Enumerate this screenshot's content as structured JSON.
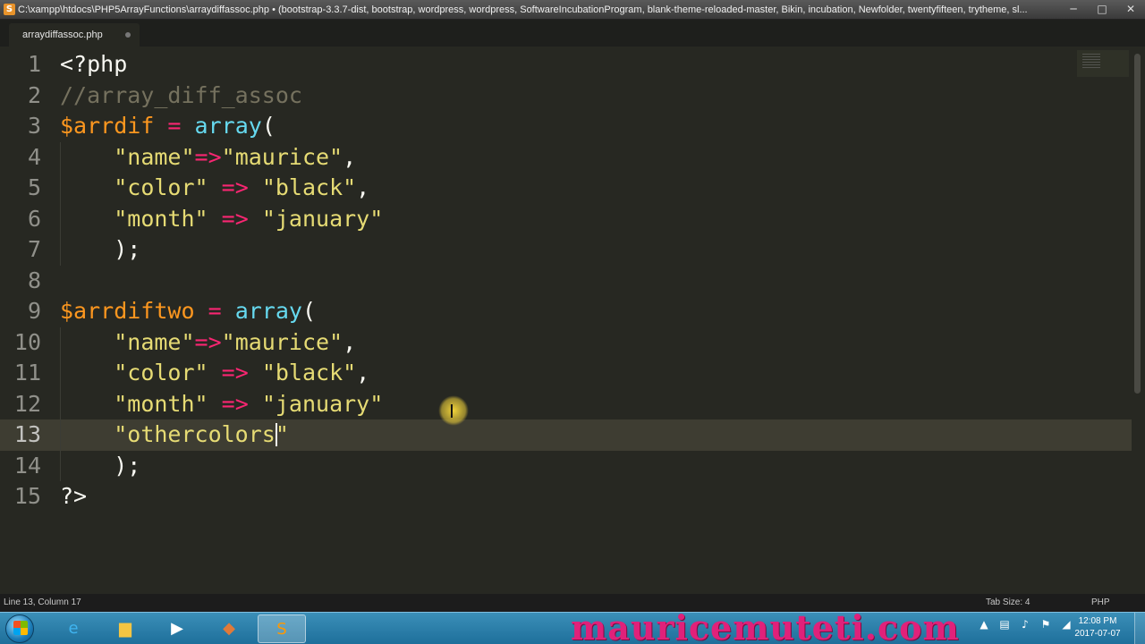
{
  "window": {
    "title": "C:\\xampp\\htdocs\\PHP5ArrayFunctions\\arraydiffassoc.php • (bootstrap-3.3.7-dist, bootstrap, wordpress, wordpress, SoftwareIncubationProgram, blank-theme-reloaded-master, Bikin, incubation, Newfolder, twentyfifteen, trytheme, sl...",
    "controls": {
      "minimize": "─",
      "maximize": "□",
      "close": "✕"
    }
  },
  "tabs": [
    {
      "label": "arraydiffassoc.php",
      "dirty": true
    }
  ],
  "editor": {
    "line_numbers": [
      "1",
      "2",
      "3",
      "4",
      "5",
      "6",
      "7",
      "8",
      "9",
      "10",
      "11",
      "12",
      "13",
      "14",
      "15"
    ],
    "active_line": 13,
    "lines": [
      [
        {
          "t": "<?php",
          "c": "pl"
        }
      ],
      [
        {
          "t": "//array_diff_assoc",
          "c": "cm"
        }
      ],
      [
        {
          "t": "$arrdif",
          "c": "var"
        },
        {
          "t": " ",
          "c": "pl"
        },
        {
          "t": "=",
          "c": "kw"
        },
        {
          "t": " ",
          "c": "pl"
        },
        {
          "t": "array",
          "c": "fn"
        },
        {
          "t": "(",
          "c": "pl"
        }
      ],
      [
        {
          "t": "    ",
          "c": "pl"
        },
        {
          "t": "\"name\"",
          "c": "str"
        },
        {
          "t": "=>",
          "c": "kw"
        },
        {
          "t": "\"maurice\"",
          "c": "str"
        },
        {
          "t": ",",
          "c": "pl"
        }
      ],
      [
        {
          "t": "    ",
          "c": "pl"
        },
        {
          "t": "\"color\"",
          "c": "str"
        },
        {
          "t": " ",
          "c": "pl"
        },
        {
          "t": "=>",
          "c": "kw"
        },
        {
          "t": " ",
          "c": "pl"
        },
        {
          "t": "\"black\"",
          "c": "str"
        },
        {
          "t": ",",
          "c": "pl"
        }
      ],
      [
        {
          "t": "    ",
          "c": "pl"
        },
        {
          "t": "\"month\"",
          "c": "str"
        },
        {
          "t": " ",
          "c": "pl"
        },
        {
          "t": "=>",
          "c": "kw"
        },
        {
          "t": " ",
          "c": "pl"
        },
        {
          "t": "\"january\"",
          "c": "str"
        }
      ],
      [
        {
          "t": "    );",
          "c": "pl"
        }
      ],
      [],
      [
        {
          "t": "$arrdiftwo",
          "c": "var"
        },
        {
          "t": " ",
          "c": "pl"
        },
        {
          "t": "=",
          "c": "kw"
        },
        {
          "t": " ",
          "c": "pl"
        },
        {
          "t": "array",
          "c": "fn"
        },
        {
          "t": "(",
          "c": "pl"
        }
      ],
      [
        {
          "t": "    ",
          "c": "pl"
        },
        {
          "t": "\"name\"",
          "c": "str"
        },
        {
          "t": "=>",
          "c": "kw"
        },
        {
          "t": "\"maurice\"",
          "c": "str"
        },
        {
          "t": ",",
          "c": "pl"
        }
      ],
      [
        {
          "t": "    ",
          "c": "pl"
        },
        {
          "t": "\"color\"",
          "c": "str"
        },
        {
          "t": " ",
          "c": "pl"
        },
        {
          "t": "=>",
          "c": "kw"
        },
        {
          "t": " ",
          "c": "pl"
        },
        {
          "t": "\"black\"",
          "c": "str"
        },
        {
          "t": ",",
          "c": "pl"
        }
      ],
      [
        {
          "t": "    ",
          "c": "pl"
        },
        {
          "t": "\"month\"",
          "c": "str"
        },
        {
          "t": " ",
          "c": "pl"
        },
        {
          "t": "=>",
          "c": "kw"
        },
        {
          "t": " ",
          "c": "pl"
        },
        {
          "t": "\"january\"",
          "c": "str"
        }
      ],
      [
        {
          "t": "    ",
          "c": "pl"
        },
        {
          "t": "\"othercolors\"",
          "c": "str"
        }
      ],
      [
        {
          "t": "    );",
          "c": "pl"
        }
      ],
      [
        {
          "t": "?>",
          "c": "pl"
        }
      ]
    ]
  },
  "status": {
    "position": "Line 13, Column 17",
    "tab_size": "Tab Size: 4",
    "syntax": "PHP"
  },
  "taskbar": {
    "apps": [
      {
        "name": "internet-explorer",
        "glyph": "e",
        "color": "#3fb4f0"
      },
      {
        "name": "file-explorer",
        "glyph": "▆",
        "color": "#f4c542"
      },
      {
        "name": "media-player",
        "glyph": "▶",
        "color": "#ffffff"
      },
      {
        "name": "app",
        "glyph": "◆",
        "color": "#e07a3a"
      },
      {
        "name": "sublime-text",
        "glyph": "S",
        "color": "#ff9800"
      }
    ],
    "watermark": "mauricemuteti.com",
    "clock_time": "12:08 PM",
    "clock_date": "2017-07-07"
  },
  "colors": {
    "background": "#272822",
    "keyword": "#f92672",
    "variable": "#fd971f",
    "function": "#66d9ef",
    "string": "#e6db74",
    "comment": "#75715e"
  }
}
